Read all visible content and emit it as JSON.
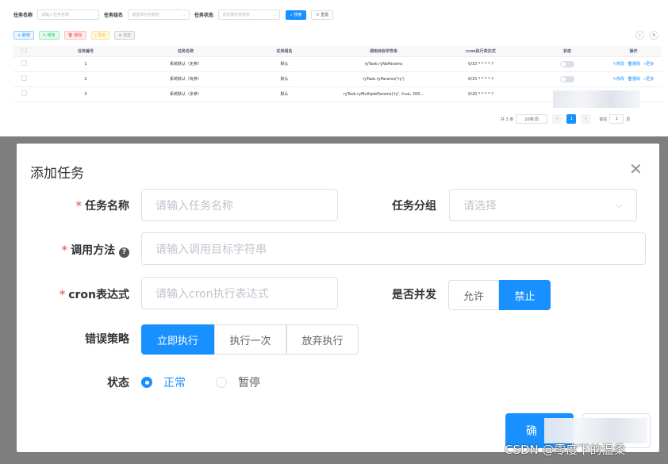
{
  "search": {
    "name_label": "任务名称",
    "name_placeholder": "请输入任务名称",
    "group_label": "任务组名",
    "group_placeholder": "请选择任务组名",
    "status_label": "任务状态",
    "status_placeholder": "请选择任务状态",
    "search_label": "搜索",
    "reset_label": "重置"
  },
  "toolbar": {
    "add": "新增",
    "edit": "修改",
    "delete": "删除",
    "export": "导出",
    "log": "日志"
  },
  "table": {
    "headers": [
      "任务编号",
      "任务名称",
      "任务组名",
      "调用目标字符串",
      "cron执行表达式",
      "状态",
      "操作"
    ],
    "rows": [
      {
        "id": "1",
        "name": "系统默认（无参）",
        "group": "默认",
        "target": "ryTask.ryNoParams",
        "cron": "0/10 * * * * ?"
      },
      {
        "id": "2",
        "name": "系统默认（有参）",
        "group": "默认",
        "target": "ryTask.ryParams('ry')",
        "cron": "0/15 * * * * ?"
      },
      {
        "id": "3",
        "name": "系统默认（多参）",
        "group": "默认",
        "target": "ryTask.ryMultipleParams('ry', true, 200...",
        "cron": "0/20 * * * * ?"
      }
    ],
    "actions": {
      "edit": "修改",
      "delete": "删除",
      "more": "更多"
    }
  },
  "pagination": {
    "total": "共 3 条",
    "page_size": "10条/页",
    "current_page": "1",
    "goto_label": "前往",
    "goto_value": "1",
    "page_unit": "页"
  },
  "dialog": {
    "title": "添加任务",
    "name_label": "任务名称",
    "name_placeholder": "请输入任务名称",
    "group_label": "任务分组",
    "group_placeholder": "请选择",
    "invoke_label": "调用方法",
    "invoke_placeholder": "请输入调用目标字符串",
    "cron_label": "cron表达式",
    "cron_placeholder": "请输入cron执行表达式",
    "concurrent_label": "是否并发",
    "concurrent_options": [
      "允许",
      "禁止"
    ],
    "misfire_label": "错误策略",
    "misfire_options": [
      "立即执行",
      "执行一次",
      "放弃执行"
    ],
    "status_label": "状态",
    "status_options": [
      "正常",
      "暂停"
    ],
    "confirm_label": "确"
  },
  "watermark": "CSDN @零度下的温柔",
  "colors": {
    "primary": "#1890ff",
    "danger": "#f56c6c",
    "success": "#13ce66",
    "warning": "#ffba00"
  }
}
